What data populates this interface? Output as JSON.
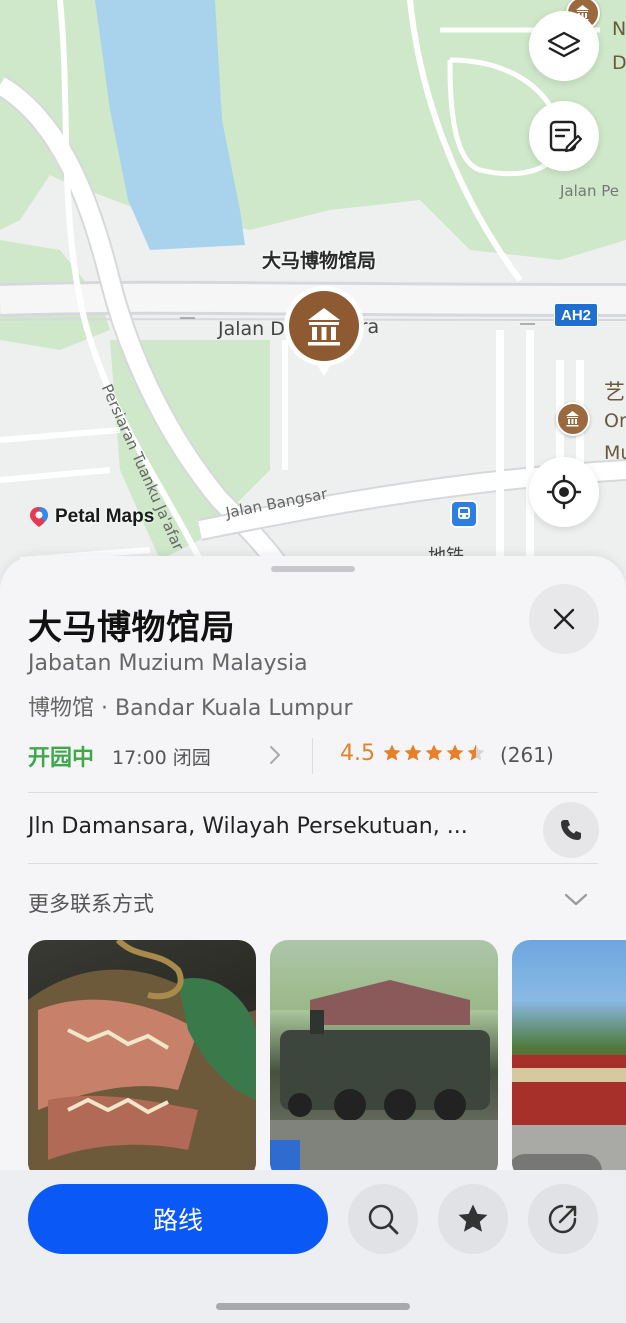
{
  "map": {
    "poi_title": "大马博物馆局",
    "road_jalan_left": "Jalan D",
    "road_jalan_right": "ara",
    "road_bangsar": "Jalan Bangsar",
    "road_persiaran": "Persiaran Tuanku Ja'afar",
    "road_jalan_pe": "Jalan Pe",
    "highway_badge": "AH2",
    "metro_label": "地铁",
    "side_label_art": "艺",
    "side_label_or": "Or",
    "side_label_mu": "Mu",
    "side_label_top1": "N",
    "side_label_top2": "D",
    "brand_name": "Petal Maps"
  },
  "place": {
    "name": "大马博物馆局",
    "name_en": "Jabatan Muzium Malaysia",
    "category_line": "博物馆 · Bandar Kuala Lumpur",
    "open_status": "开园中",
    "close_time": "17:00 闭园",
    "rating": "4.5",
    "stars": 4.5,
    "reviews": "(261)",
    "address": "Jln Damansara, Wilayah Persekutuan, ...",
    "more_contact": "更多联系方式"
  },
  "actions": {
    "route_label": "路线"
  },
  "colors": {
    "accent": "#0a59f7",
    "open_green": "#3fa94a",
    "rating_orange": "#e8802a",
    "poi_brown": "#9a6a3e"
  }
}
